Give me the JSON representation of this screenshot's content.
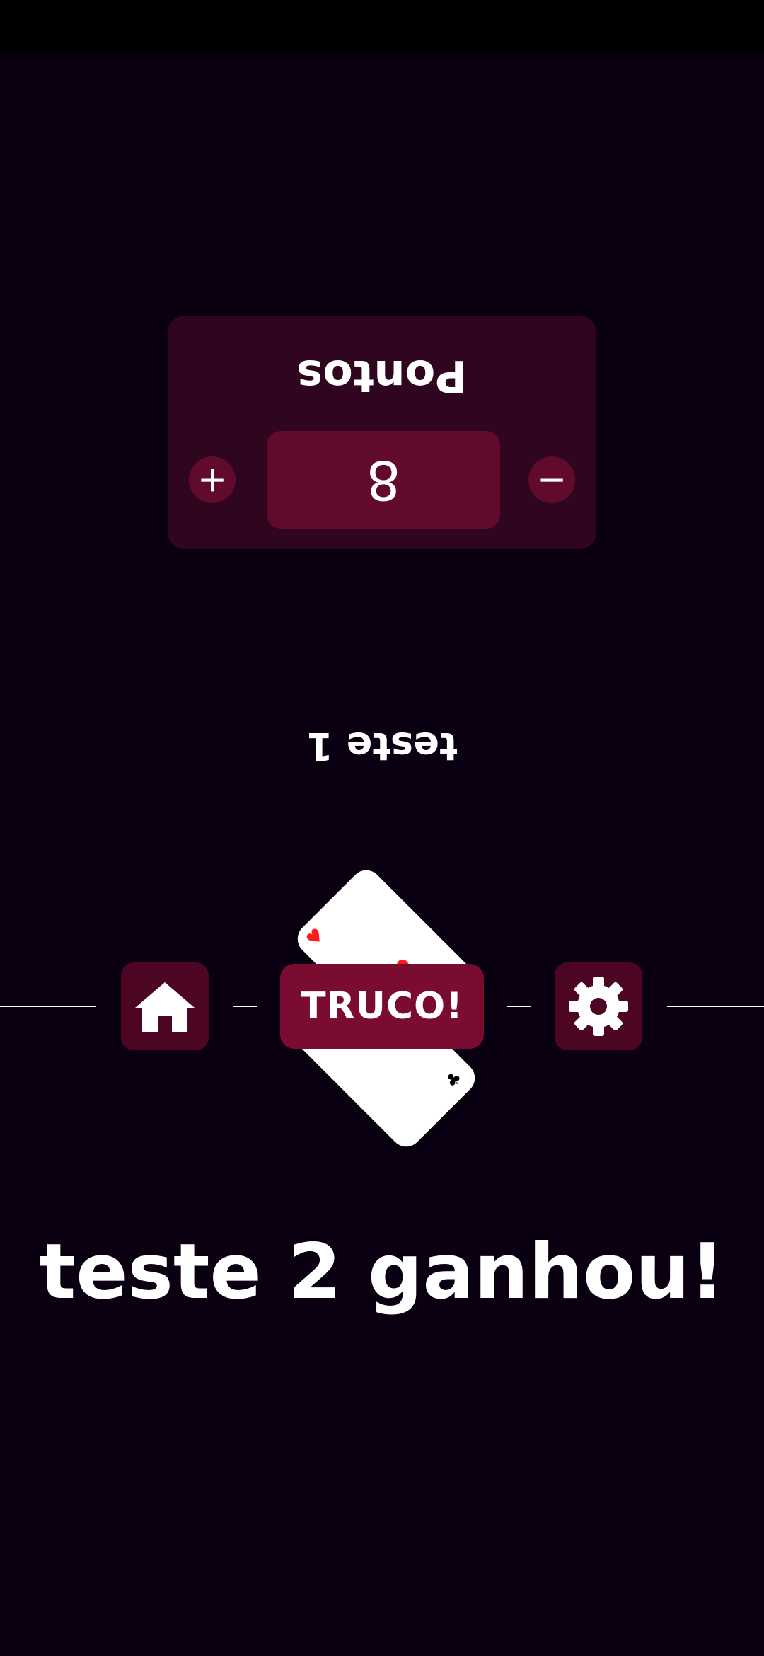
{
  "player1": {
    "name": "teste 1",
    "score_title": "Pontos",
    "score": "8",
    "increment_label": "+",
    "decrement_label": "−"
  },
  "actions": {
    "truco_label": "TRUCO!",
    "home_icon": "home-icon",
    "settings_icon": "gear-icon"
  },
  "cards": {
    "top_suit": "♥",
    "bottom_suit": "♣"
  },
  "result": {
    "message": "teste 2 ganhou!"
  },
  "colors": {
    "background": "#0a0012",
    "card_panel": "#2f0520",
    "score_box": "#620a2c",
    "button": "#4c0522",
    "truco": "#7a0c32",
    "heart": "#ff1a1a",
    "club": "#000000"
  }
}
